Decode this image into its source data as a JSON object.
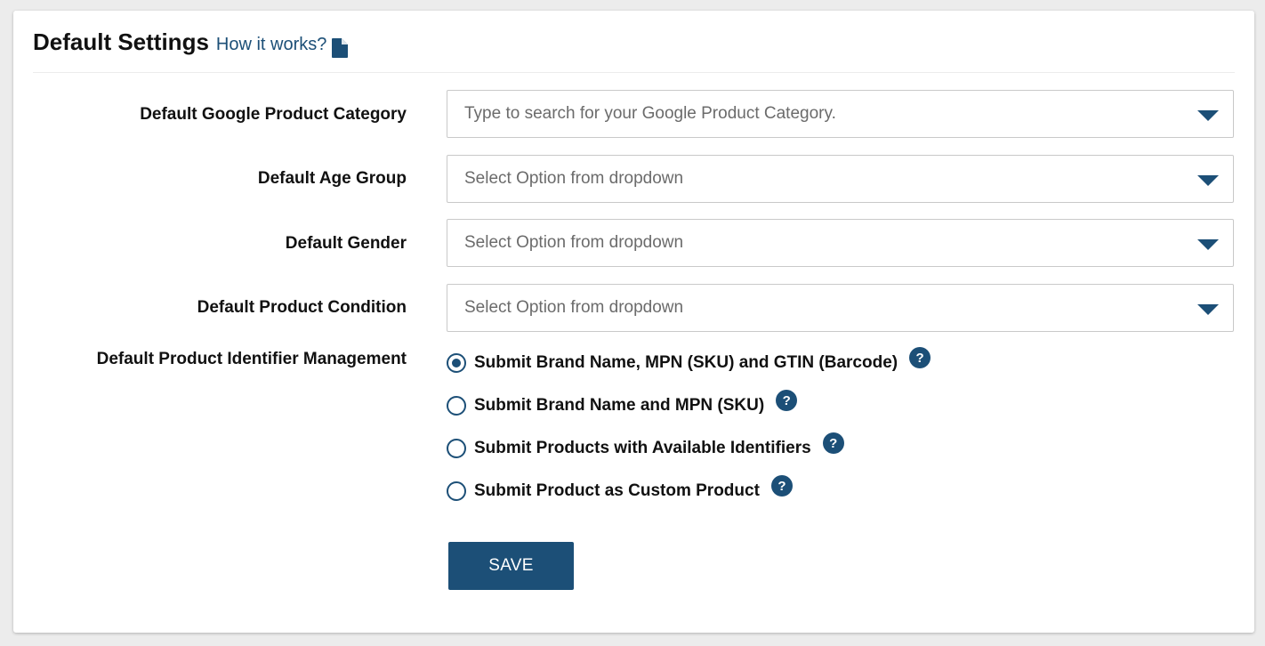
{
  "header": {
    "title": "Default Settings",
    "how_link": "How it works?",
    "doc_icon": "document-icon"
  },
  "fields": [
    {
      "label": "Default Google Product Category",
      "placeholder": "Type to search for your Google Product Category."
    },
    {
      "label": "Default Age Group",
      "placeholder": "Select Option from dropdown"
    },
    {
      "label": "Default Gender",
      "placeholder": "Select Option from dropdown"
    },
    {
      "label": "Default Product Condition",
      "placeholder": "Select Option from dropdown"
    }
  ],
  "identifier": {
    "label": "Default Product Identifier Management",
    "options": [
      {
        "label": "Submit Brand Name, MPN (SKU) and GTIN (Barcode)",
        "checked": true,
        "help": "?"
      },
      {
        "label": "Submit Brand Name and MPN (SKU)",
        "checked": false,
        "help": "?"
      },
      {
        "label": "Submit Products with Available Identifiers",
        "checked": false,
        "help": "?"
      },
      {
        "label": "Submit Product as Custom Product",
        "checked": false,
        "help": "?"
      }
    ]
  },
  "save_label": "SAVE",
  "colors": {
    "accent": "#1c4f77"
  }
}
